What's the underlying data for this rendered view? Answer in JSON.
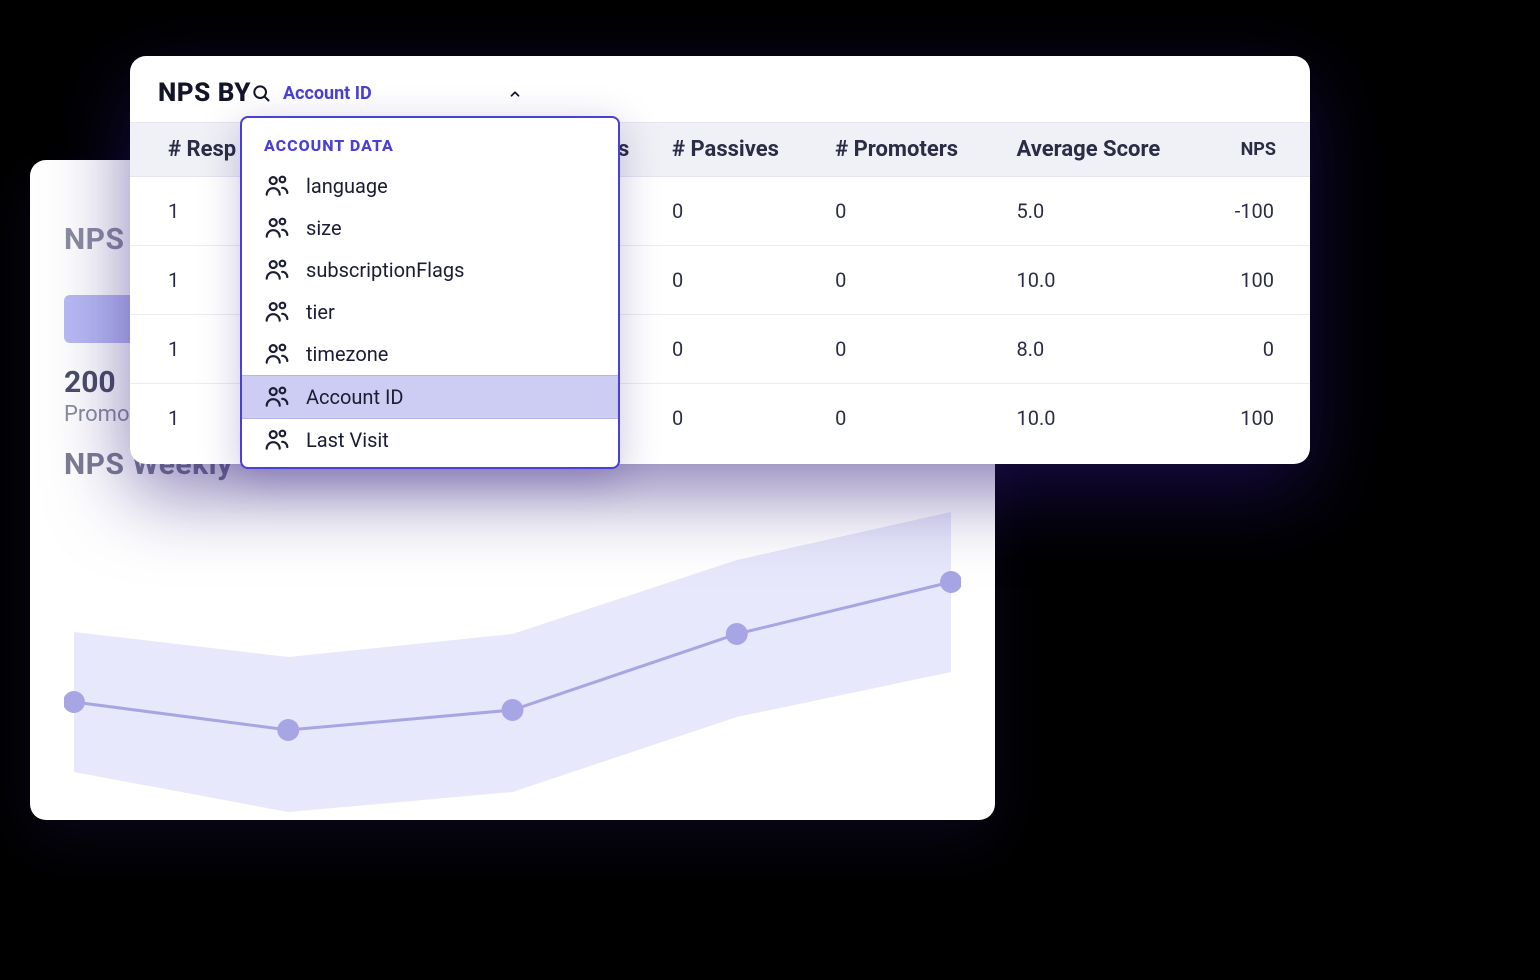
{
  "back_card": {
    "title_trunc": "NPS",
    "stat_number": "200",
    "stat_label": "Promo",
    "weekly_title": "NPS Weekly"
  },
  "chart_data": {
    "type": "line",
    "x": [
      0,
      1,
      2,
      3,
      4
    ],
    "values": [
      40,
      32,
      38,
      62,
      78
    ],
    "band_low": [
      18,
      8,
      12,
      35,
      50
    ],
    "band_high": [
      62,
      55,
      62,
      85,
      100
    ],
    "ylim": [
      0,
      100
    ]
  },
  "front_card": {
    "title_prefix": "NPS BY",
    "selected_label": "Account ID",
    "columns": [
      "# Responses",
      "# Detractors",
      "# Passives",
      "# Promoters",
      "Average Score",
      "NPS"
    ],
    "columns_visible": {
      "c0": "# Resp",
      "c1": "s",
      "c2": "# Passives",
      "c3": "# Promoters",
      "c4": "Average Score",
      "c5": "NPS"
    },
    "rows": [
      {
        "responses": "1",
        "passives": "0",
        "promoters": "0",
        "avg": "5.0",
        "nps": "-100"
      },
      {
        "responses": "1",
        "passives": "0",
        "promoters": "0",
        "avg": "10.0",
        "nps": "100"
      },
      {
        "responses": "1",
        "passives": "0",
        "promoters": "0",
        "avg": "8.0",
        "nps": "0"
      },
      {
        "responses": "1",
        "passives": "0",
        "promoters": "0",
        "avg": "10.0",
        "nps": "100"
      }
    ]
  },
  "dropdown": {
    "section_label": "ACCOUNT DATA",
    "items": [
      {
        "label": "language",
        "selected": false
      },
      {
        "label": "size",
        "selected": false
      },
      {
        "label": "subscriptionFlags",
        "selected": false
      },
      {
        "label": "tier",
        "selected": false
      },
      {
        "label": "timezone",
        "selected": false
      },
      {
        "label": "Account ID",
        "selected": true
      },
      {
        "label": "Last Visit",
        "selected": false
      }
    ]
  }
}
